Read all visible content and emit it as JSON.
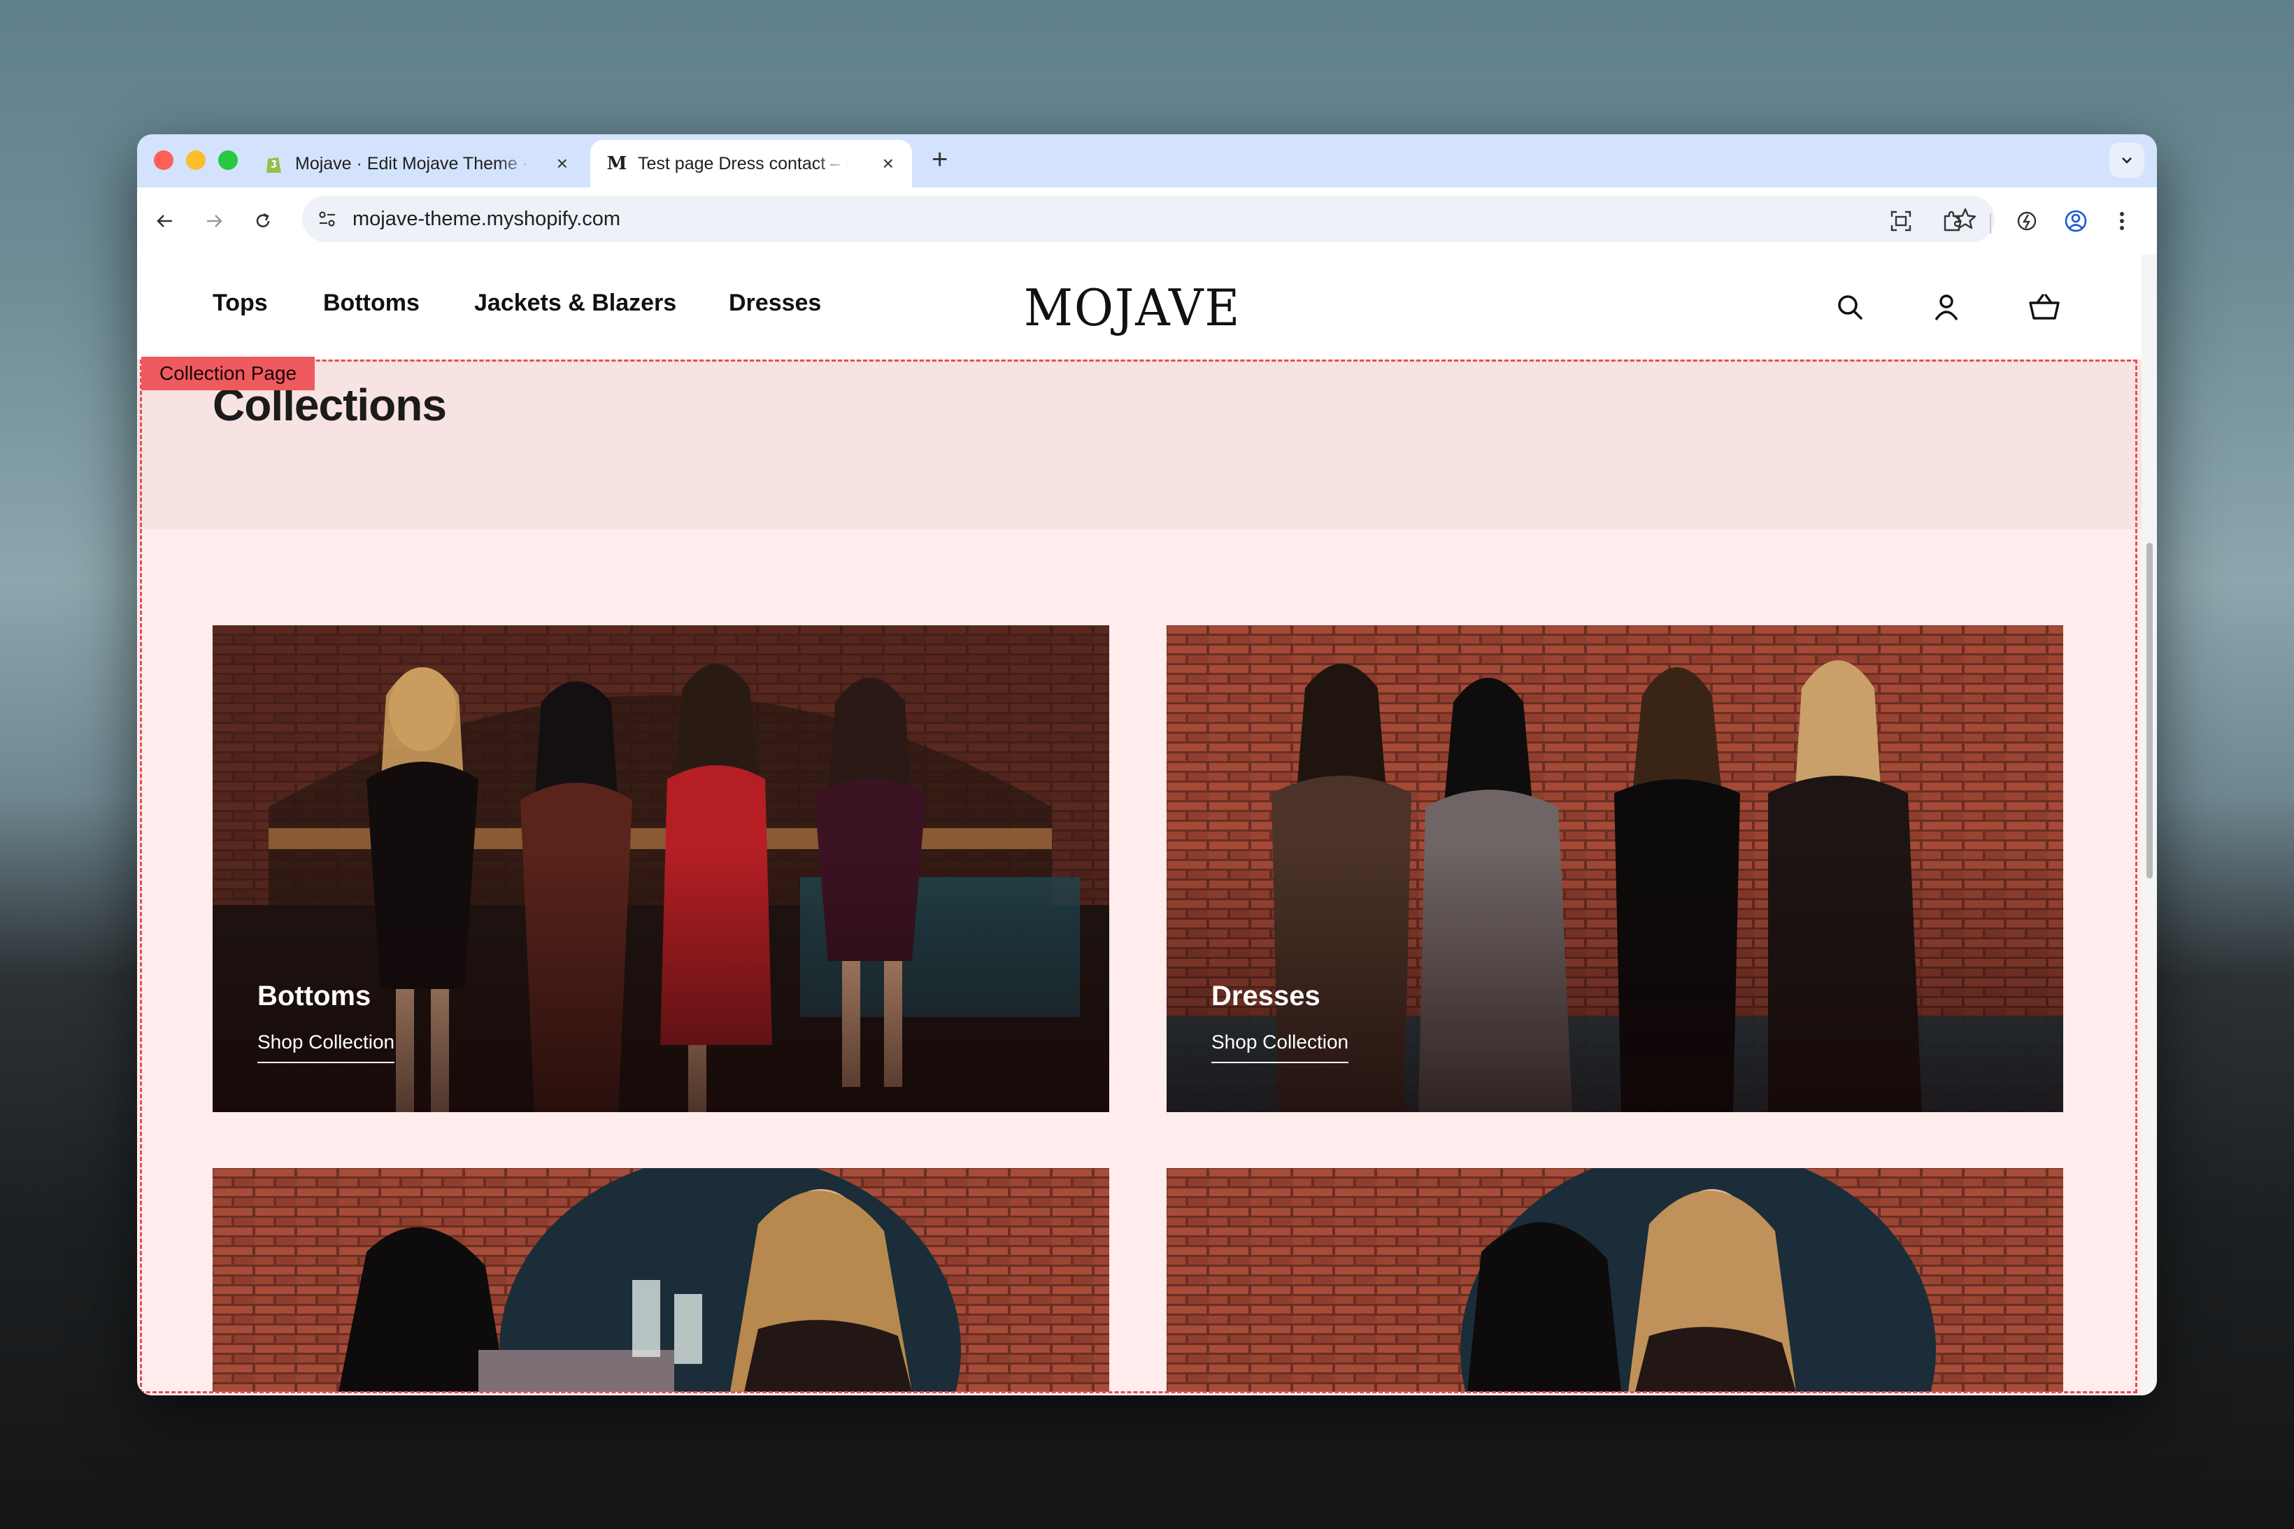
{
  "browser": {
    "tabs": [
      {
        "title": "Mojave · Edit Mojave Theme · Shopify",
        "favicon": "shopify-icon",
        "active": false
      },
      {
        "title": "Test page Dress contact – Mojave",
        "favicon": "mojave-m-icon",
        "favicon_letter": "M",
        "active": true
      }
    ],
    "new_tab_label": "+",
    "close_label": "×",
    "url": "mojave-theme.myshopify.com"
  },
  "site": {
    "nav": [
      "Tops",
      "Bottoms",
      "Jackets & Blazers",
      "Dresses"
    ],
    "logo": "MOJAVE"
  },
  "page": {
    "editor_label": "Collection Page",
    "title": "Collections",
    "collections": [
      {
        "title": "Bottoms",
        "link": "Shop Collection"
      },
      {
        "title": "Dresses",
        "link": "Shop Collection"
      },
      {
        "title": "",
        "link": ""
      },
      {
        "title": "",
        "link": ""
      }
    ]
  },
  "colors": {
    "tab_bar": "#d3e3fd",
    "page_bg": "#ffeced",
    "banner_bg": "#f7e3e1",
    "editor_outline": "#e34e55"
  }
}
